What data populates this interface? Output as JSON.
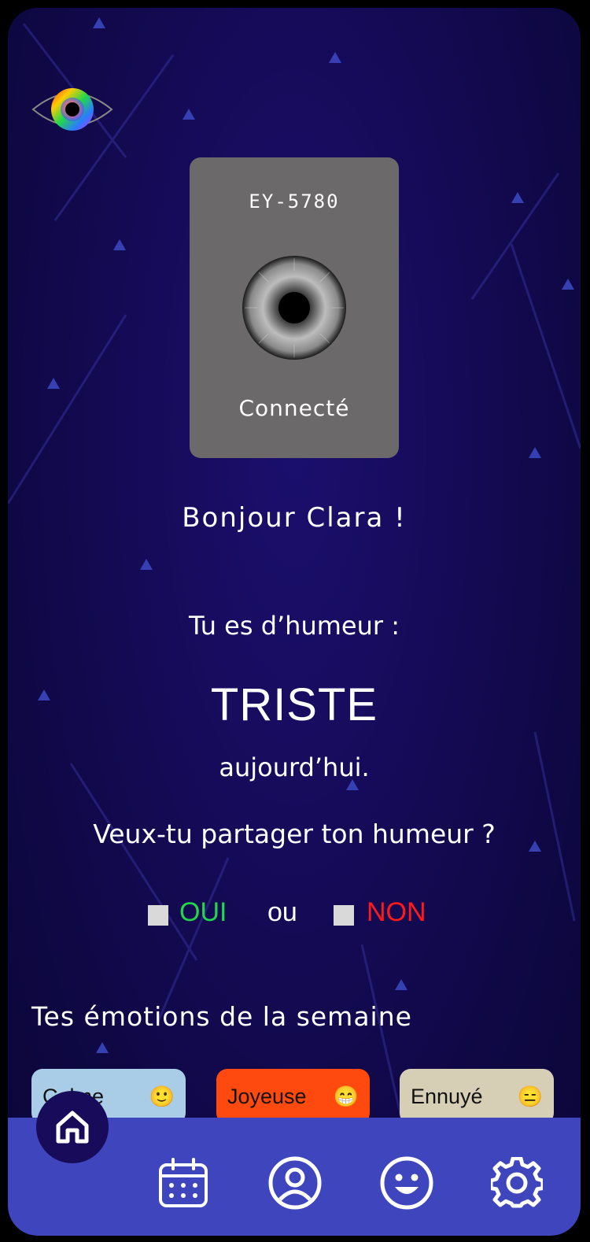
{
  "device": {
    "id": "EY-5780",
    "status": "Connecté"
  },
  "greeting": "Bonjour  Clara !",
  "mood": {
    "intro": "Tu es d’humeur :",
    "value": "TRISTE",
    "suffix": "aujourd’hui."
  },
  "share": {
    "question": "Veux-tu partager ton humeur ?",
    "yes_label": "OUI",
    "or_label": "ou",
    "no_label": "NON",
    "yes_color": "#22d84a",
    "no_color": "#ff1a1a"
  },
  "week": {
    "title": "Tes émotions de la semaine",
    "emotions": [
      {
        "label": "Calme",
        "emoji": "🙂",
        "color": "#a9cde6"
      },
      {
        "label": "Joyeuse",
        "emoji": "😁",
        "color": "#ff4a0f"
      },
      {
        "label": "Ennuyé",
        "emoji": "😑",
        "color": "#d6cfb6"
      }
    ]
  },
  "nav": {
    "items": [
      "home-icon",
      "calendar-icon",
      "profile-icon",
      "smiley-icon",
      "gear-icon"
    ],
    "bar_color": "#3f45bd"
  }
}
